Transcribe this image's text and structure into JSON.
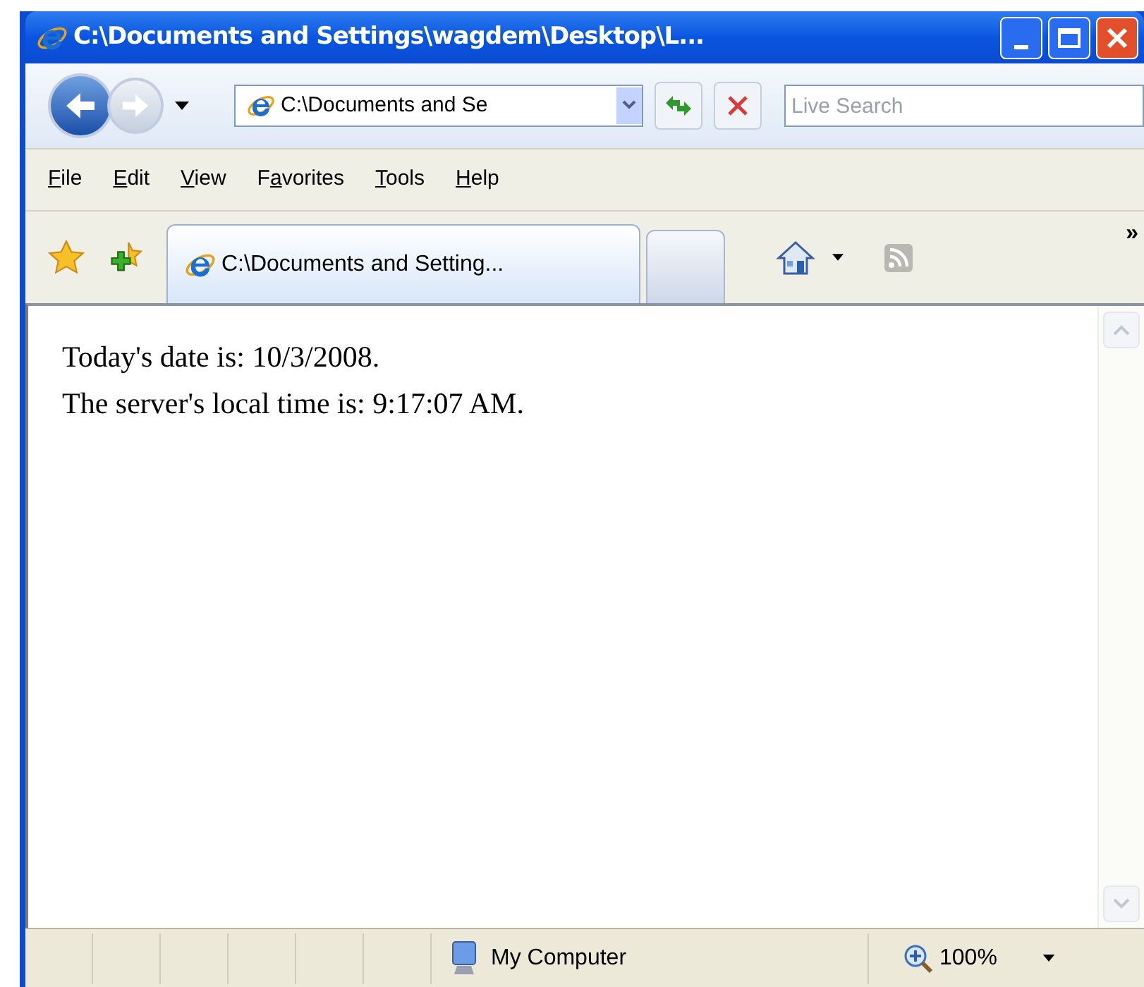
{
  "window": {
    "title": "C:\\Documents and Settings\\wagdem\\Desktop\\L..."
  },
  "address_bar": {
    "value": "C:\\Documents and Se"
  },
  "search": {
    "placeholder": "Live Search"
  },
  "menu": [
    {
      "key": "F",
      "post": "ile"
    },
    {
      "key": "E",
      "post": "dit"
    },
    {
      "key": "V",
      "post": "iew"
    },
    {
      "pre": "F",
      "key": "a",
      "post": "vorites"
    },
    {
      "key": "T",
      "post": "ools"
    },
    {
      "key": "H",
      "post": "elp"
    }
  ],
  "tabs": [
    {
      "kind": "page",
      "label": "C:\\Documents and Setting...",
      "selected": true
    },
    {
      "kind": "new",
      "selected": false
    }
  ],
  "chevron": "»",
  "content": [
    "Today's date is: 10/3/2008.",
    "The server's local time is: 9:17:07 AM."
  ],
  "status_bar": {
    "zone": "My Computer",
    "zoom": "100%"
  }
}
